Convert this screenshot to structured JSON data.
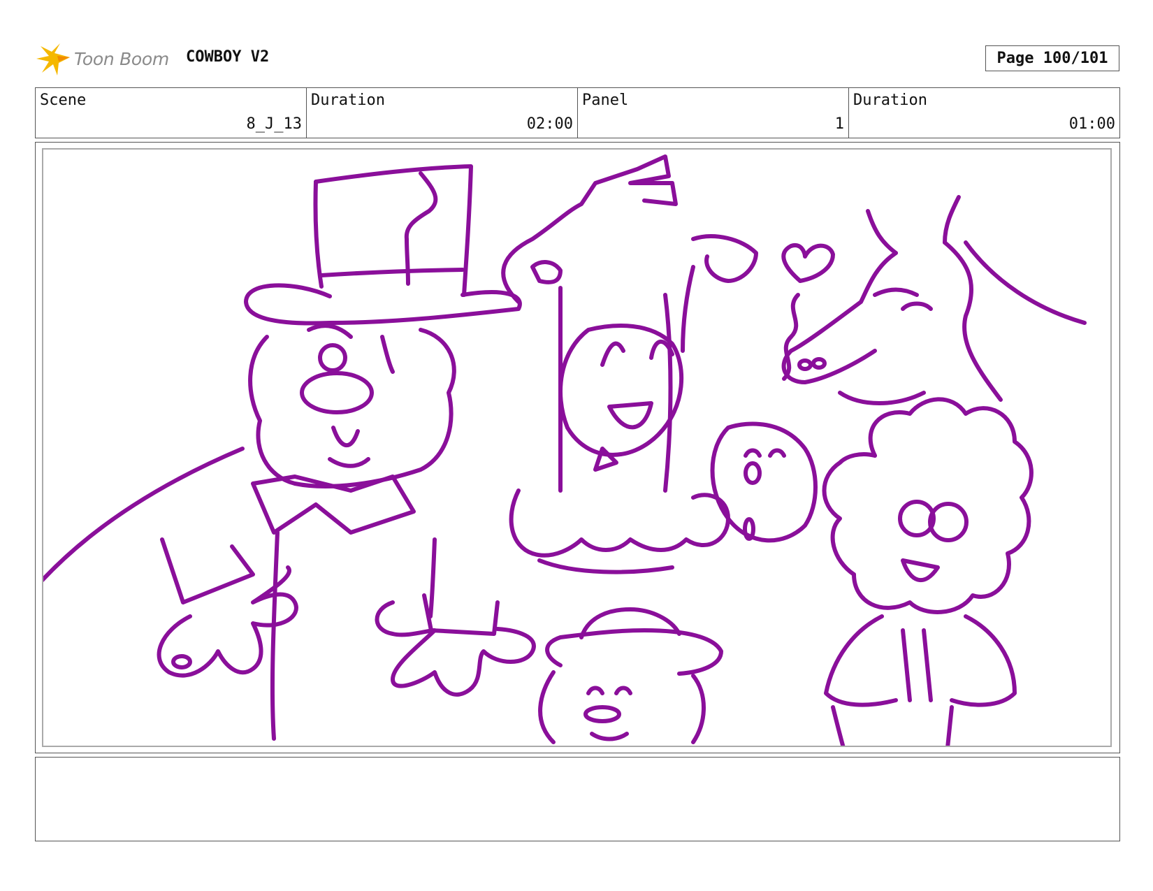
{
  "header": {
    "logo_text": "Toon Boom",
    "project_title": "COWBOY V2",
    "page_label": "Page 100/101"
  },
  "info": {
    "scene_label": "Scene",
    "scene_value": "8_J_13",
    "scene_duration_label": "Duration",
    "scene_duration_value": "02:00",
    "panel_label": "Panel",
    "panel_value": "1",
    "panel_duration_label": "Duration",
    "panel_duration_value": "01:00"
  },
  "colors": {
    "sketch_line": "#8a0f9a",
    "logo_star": "#f5b800",
    "border": "#555555"
  },
  "notes": {
    "text": ""
  }
}
